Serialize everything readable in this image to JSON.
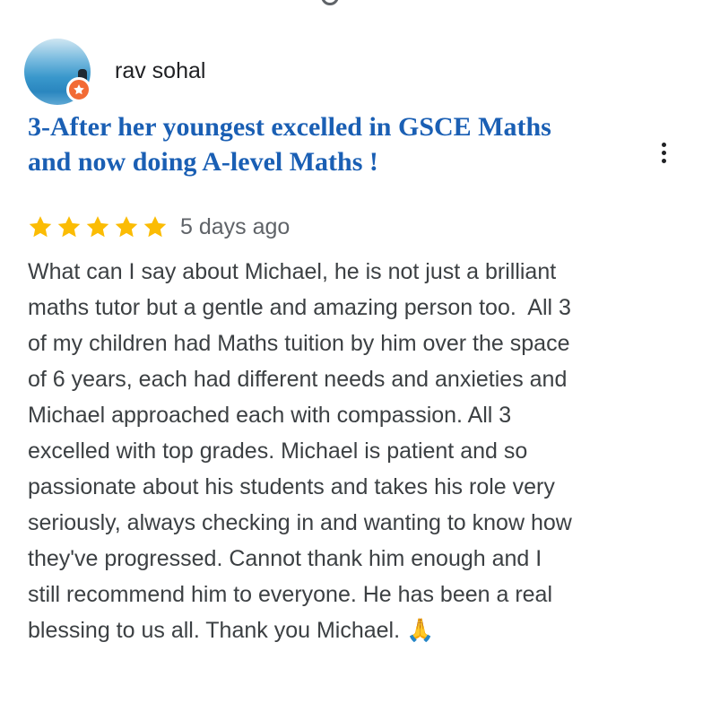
{
  "review": {
    "reviewer_name": "rav sohal",
    "title_line1": "3-After her youngest excelled in GSCE Maths",
    "title_line2": "and now doing A-level Maths !",
    "rating": 5,
    "rating_max": 5,
    "date": "5 days ago",
    "body_lines": [
      "What can I say about Michael, he is not just a brilliant",
      "maths tutor but a gentle and amazing person too.  All 3",
      "of my children had Maths tuition by him over the space",
      "of 6 years, each had different needs and anxieties and",
      "Michael approached each with compassion. All 3",
      "excelled with top grades. Michael is patient and so",
      "passionate about his students and takes his role very",
      "seriously, always checking in and wanting to know how",
      "they've progressed. Cannot thank him enough and I",
      "still recommend him to everyone. He has been a real",
      "blessing to us all. Thank you Michael. 🙏"
    ]
  },
  "icons": {
    "avatar_badge": "local-guide-star-icon",
    "more": "more-vert-icon",
    "star": "star-icon"
  },
  "colors": {
    "title": "#1a5fb4",
    "star": "#fbbc04",
    "badge": "#f26b35"
  }
}
